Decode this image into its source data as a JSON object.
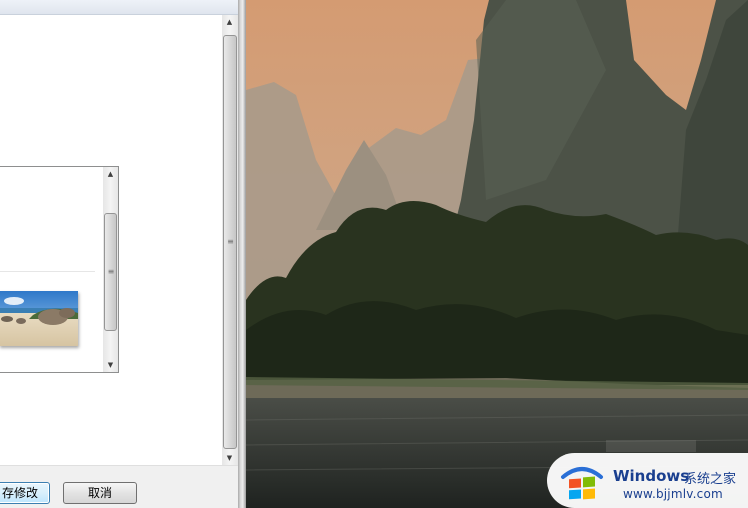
{
  "dialog": {
    "save_label": "存修改",
    "cancel_label": "取消"
  },
  "watermark": {
    "brand": "Windows",
    "brand_cn": "系统之家",
    "url": "www.bjjmlv.com"
  },
  "icons": {
    "scroll_up": "scroll-up-arrow-icon",
    "scroll_down": "scroll-down-arrow-icon",
    "logo": "windows-logo-icon"
  },
  "colors": {
    "dialog_bg": "#f0f0f0",
    "content_bg": "#ffffff",
    "save_border": "#3c7fb1",
    "brand_text": "#1a3f8f"
  }
}
